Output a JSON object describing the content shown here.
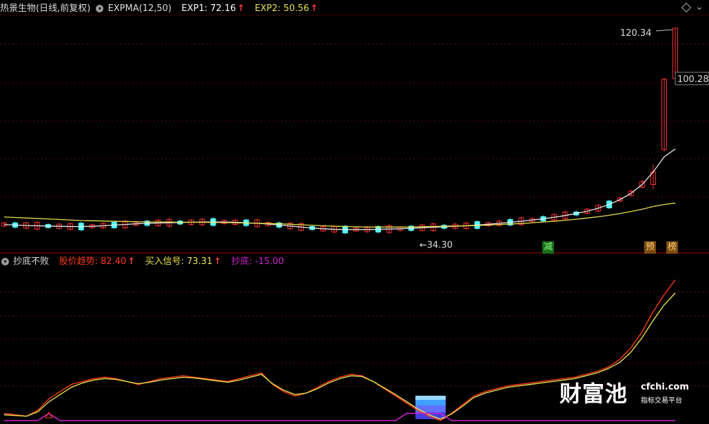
{
  "header_main": {
    "stock": "热景生物(日线,前复权)",
    "indicator": "EXPMA(12,50)",
    "exp1_label": "EXP1: 72.16",
    "exp2_label": "EXP2: 50.56",
    "arrow": "↑"
  },
  "header_sub": {
    "indicator": "抄底不败",
    "trend_label": "股价趋势: 82.40",
    "buy_label": "买入信号: 73.31",
    "bottom_label": "抄底: -15.00",
    "arrow": "↑"
  },
  "annotations": {
    "high": "120.34",
    "low": "34.30",
    "last": "100.28"
  },
  "signals": {
    "reduce": "减",
    "pre": "预",
    "rank": "榜"
  },
  "watermark": {
    "brand": "财富池",
    "url": "cfchi.com",
    "sub": "指标交易平台"
  },
  "colors": {
    "up": "#ff3030",
    "down": "#54ffff",
    "exp1": "#e8e8e8",
    "exp2": "#e8e050",
    "trend": "#ff3a1a",
    "buy": "#e8e050",
    "bottom": "#d020d0",
    "grid": "#7a0000"
  },
  "chart_data": [
    {
      "type": "candlestick",
      "title": "热景生物(日线,前复权)",
      "series": [
        {
          "name": "EXP1",
          "values": [
            42,
            41.8,
            41.6,
            41.5,
            41.4,
            41.3,
            41.2,
            41.2,
            41.3,
            41.5,
            41.8,
            42,
            42.3,
            42.5,
            42.6,
            42.7,
            42.8,
            42.9,
            43,
            43,
            43,
            42.9,
            42.7,
            42.5,
            42.2,
            41.8,
            41.4,
            41,
            40.6,
            40.3,
            40.1,
            40,
            40,
            40,
            40.1,
            40.2,
            40.3,
            40.5,
            40.7,
            40.9,
            41.1,
            41.3,
            41.5,
            41.8,
            42.1,
            42.5,
            42.9,
            43.3,
            43.8,
            44.3,
            44.9,
            45.6,
            46.4,
            47.3,
            48.5,
            50,
            52,
            54.5,
            58,
            63,
            69,
            72.16
          ]
        },
        {
          "name": "EXP2",
          "values": [
            45,
            44.8,
            44.6,
            44.4,
            44.2,
            44,
            43.8,
            43.6,
            43.5,
            43.4,
            43.3,
            43.2,
            43.1,
            43,
            43,
            43,
            42.9,
            42.9,
            42.9,
            42.8,
            42.8,
            42.7,
            42.6,
            42.5,
            42.4,
            42.3,
            42.1,
            41.9,
            41.7,
            41.5,
            41.3,
            41.2,
            41.1,
            41,
            41,
            41,
            41,
            41,
            41.1,
            41.2,
            41.3,
            41.4,
            41.5,
            41.6,
            41.8,
            42,
            42.2,
            42.4,
            42.7,
            43,
            43.3,
            43.7,
            44.1,
            44.6,
            45.1,
            45.7,
            46.4,
            47.2,
            48.1,
            49.2,
            50,
            50.56
          ]
        }
      ],
      "ylim": [
        32,
        125
      ],
      "y_annotations": {
        "high": 120.34,
        "low": 34.3,
        "last": 100.28
      }
    },
    {
      "type": "line",
      "title": "抄底不败",
      "series": [
        {
          "name": "股价趋势",
          "values": [
            -10,
            -11,
            -12,
            -8,
            0,
            5,
            10,
            12,
            14,
            15,
            14,
            12,
            10,
            12,
            14,
            15,
            16,
            15,
            14,
            13,
            12,
            14,
            16,
            18,
            10,
            5,
            2,
            4,
            8,
            12,
            15,
            17,
            16,
            12,
            7,
            2,
            -3,
            -8,
            -12,
            -15,
            -10,
            -4,
            2,
            5,
            7,
            9,
            10,
            11,
            12,
            13,
            14,
            15,
            17,
            19,
            22,
            27,
            35,
            46,
            60,
            72,
            82.4
          ]
        },
        {
          "name": "买入信号",
          "values": [
            -11,
            -11.5,
            -12,
            -9,
            -2,
            3,
            8,
            11,
            13,
            14,
            13.5,
            12,
            10.5,
            11.5,
            13,
            14,
            15,
            14.5,
            13.5,
            12.5,
            11.5,
            13,
            15,
            17,
            10.5,
            6,
            3,
            4,
            7,
            11,
            14,
            16,
            15.5,
            12,
            7.5,
            3,
            -2,
            -7,
            -11,
            -14,
            -10.5,
            -5,
            1,
            4,
            6,
            8,
            9,
            10,
            11,
            12,
            13,
            14,
            16,
            18,
            21,
            25,
            32,
            42,
            54,
            65,
            73.31
          ]
        },
        {
          "name": "抄底",
          "values": [
            -15,
            -15,
            -15,
            -15,
            -10,
            -15,
            -15,
            -15,
            -15,
            -15,
            -15,
            -15,
            -15,
            -15,
            -15,
            -15,
            -15,
            -15,
            -15,
            -15,
            -15,
            -15,
            -15,
            -15,
            -15,
            -15,
            -15,
            -15,
            -15,
            -15,
            -15,
            -15,
            -15,
            -15,
            -15,
            -15,
            -10,
            -10,
            -10,
            -10,
            -15,
            -15,
            -15,
            -15,
            -15,
            -15,
            -15,
            -15,
            -15,
            -15,
            -15,
            -15,
            -15,
            -15,
            -15,
            -15,
            -15,
            -15,
            -15,
            -15,
            -15
          ]
        }
      ],
      "ylim": [
        -15,
        90
      ]
    }
  ]
}
